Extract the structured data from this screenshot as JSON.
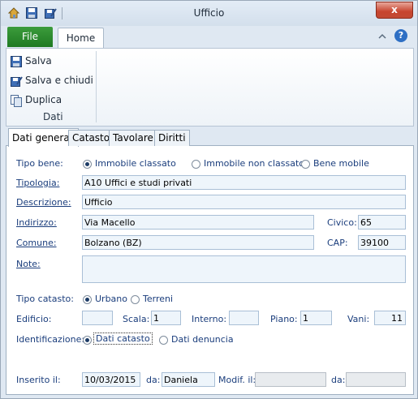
{
  "window": {
    "title": "Ufficio",
    "close": "x"
  },
  "ribbon": {
    "file_tab": "File",
    "home_tab": "Home",
    "buttons": {
      "save": "Salva",
      "save_close": "Salva e chiudi",
      "duplicate": "Duplica"
    },
    "group_label": "Dati"
  },
  "tabs": [
    "Dati generali",
    "Catasto",
    "Tavolare",
    "Diritti"
  ],
  "form": {
    "tipo_bene": {
      "label": "Tipo bene:",
      "options": [
        "Immobile classato",
        "Immobile non classato",
        "Bene mobile"
      ],
      "selected": "Immobile classato"
    },
    "tipologia": {
      "label": "Tipologia:",
      "value": "A10 Uffici e studi privati"
    },
    "descrizione": {
      "label": "Descrizione:",
      "value": "Ufficio"
    },
    "indirizzo": {
      "label": "Indirizzo:",
      "value": "Via Macello"
    },
    "civico": {
      "label": "Civico:",
      "value": "65"
    },
    "comune": {
      "label": "Comune:",
      "value": "Bolzano (BZ)"
    },
    "cap": {
      "label": "CAP:",
      "value": "39100"
    },
    "note": {
      "label": "Note:",
      "value": ""
    },
    "tipo_catasto": {
      "label": "Tipo catasto:",
      "options": [
        "Urbano",
        "Terreni"
      ],
      "selected": "Urbano"
    },
    "edificio": {
      "label": "Edificio:",
      "value": ""
    },
    "scala": {
      "label": "Scala:",
      "value": "1"
    },
    "interno": {
      "label": "Interno:",
      "value": ""
    },
    "piano": {
      "label": "Piano:",
      "value": "1"
    },
    "vani": {
      "label": "Vani:",
      "value": "11"
    },
    "identificazione": {
      "label": "Identificazione:",
      "options": [
        "Dati catasto",
        "Dati denuncia"
      ],
      "selected": "Dati catasto"
    },
    "inserito_il": {
      "label": "Inserito il:",
      "value": "10/03/2015"
    },
    "inserito_da": {
      "label": "da:",
      "value": "Daniela"
    },
    "modif_il": {
      "label": "Modif. il:",
      "value": ""
    },
    "modif_da": {
      "label": "da:",
      "value": ""
    }
  }
}
